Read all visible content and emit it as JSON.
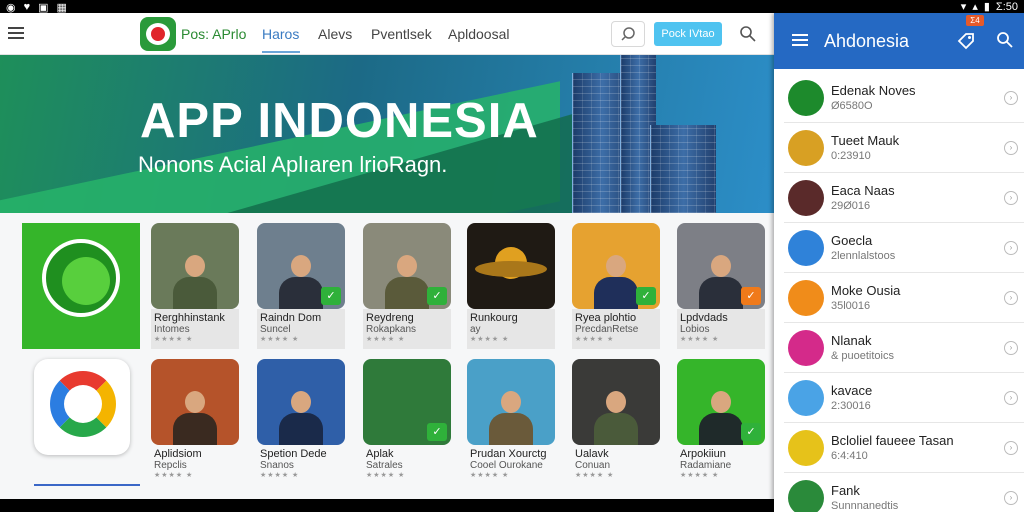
{
  "status_bar": {
    "time": "Σ:50"
  },
  "header": {
    "brand": "Pos: APrlo",
    "nav": [
      "Haros",
      "Alevs",
      "Pventlsek",
      "Apldoosal"
    ],
    "cta_label": "Pock IVtao"
  },
  "banner": {
    "title": "APP INDONESIA",
    "subtitle": "Nonons Acial Aplıaren lrioRagn."
  },
  "apps_row1": [
    {
      "title": "Rerghhinstank",
      "subtitle": "Intomes",
      "bg": "#6a7a5a"
    },
    {
      "title": "Raindn Dom",
      "subtitle": "Suncel",
      "bg": "#6e7f8e"
    },
    {
      "title": "Reydreng",
      "subtitle": "Rokapkans",
      "bg": "#8a8a7a"
    },
    {
      "title": "Runkourg",
      "subtitle": "ay",
      "bg": "#1f1a14"
    },
    {
      "title": "Ryea plohtio",
      "subtitle": "PrecdanRetse",
      "bg": "#e6a230"
    },
    {
      "title": "Lpdvdads",
      "subtitle": "Lobios",
      "bg": "#7d7f86"
    }
  ],
  "apps_row2": [
    {
      "title": "Aplidsiom",
      "subtitle": "Repclis",
      "bg": "#b5532a"
    },
    {
      "title": "Spetion Dede",
      "subtitle": "Snanos",
      "bg": "#2f5fa8"
    },
    {
      "title": "Aplak",
      "subtitle": "Satrales",
      "bg": "#2f7a3a"
    },
    {
      "title": "Prudan Xourctg",
      "subtitle": "Cooel Ourokane",
      "bg": "#4aa0c8"
    },
    {
      "title": "Ualavk",
      "subtitle": "Conuan",
      "bg": "#3a3a38"
    },
    {
      "title": "Arpokiiun",
      "subtitle": "Radamiane",
      "bg": "#35b52a"
    }
  ],
  "drawer": {
    "title": "Ahdonesia",
    "badge": "Σ4",
    "items": [
      {
        "name": "Edenak Noves",
        "meta": "Ø6580O",
        "color": "#1d8a2c"
      },
      {
        "name": "Tueet Mauk",
        "meta": "0:23910",
        "color": "#d8a023"
      },
      {
        "name": "Eaca Naas",
        "meta": "29Ø016",
        "color": "#5a2a2a"
      },
      {
        "name": "Goecla",
        "meta": "2lennlalstoos",
        "color": "#2f82d9"
      },
      {
        "name": "Moke Ousia",
        "meta": "35l0016",
        "color": "#f08c1a"
      },
      {
        "name": "Nlanak",
        "meta": "& puoetitoics",
        "color": "#d42a8a"
      },
      {
        "name": "kavace",
        "meta": "2:30016",
        "color": "#4aa3e6"
      },
      {
        "name": "Bcloliel faueee Tasan",
        "meta": "6:4:410",
        "color": "#e6c21a"
      },
      {
        "name": "Fank",
        "meta": "Sunnnanedtis",
        "color": "#2a8a3a"
      }
    ]
  }
}
